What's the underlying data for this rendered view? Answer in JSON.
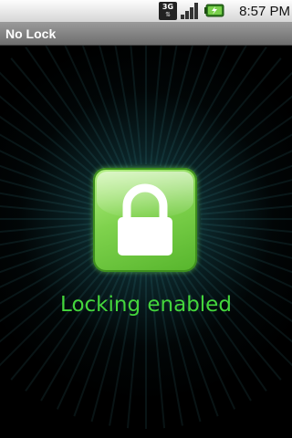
{
  "status_bar": {
    "network_type": "3G",
    "time": "8:57 PM",
    "icons": [
      "network-3g-icon",
      "signal-strength-icon",
      "battery-charging-icon"
    ]
  },
  "app": {
    "title": "No Lock"
  },
  "main": {
    "lock_icon": "lock-icon",
    "status_text": "Locking enabled"
  },
  "colors": {
    "status_text": "#44d63c",
    "tile_green": "#7fd24d",
    "glow": "#3caaaf"
  }
}
